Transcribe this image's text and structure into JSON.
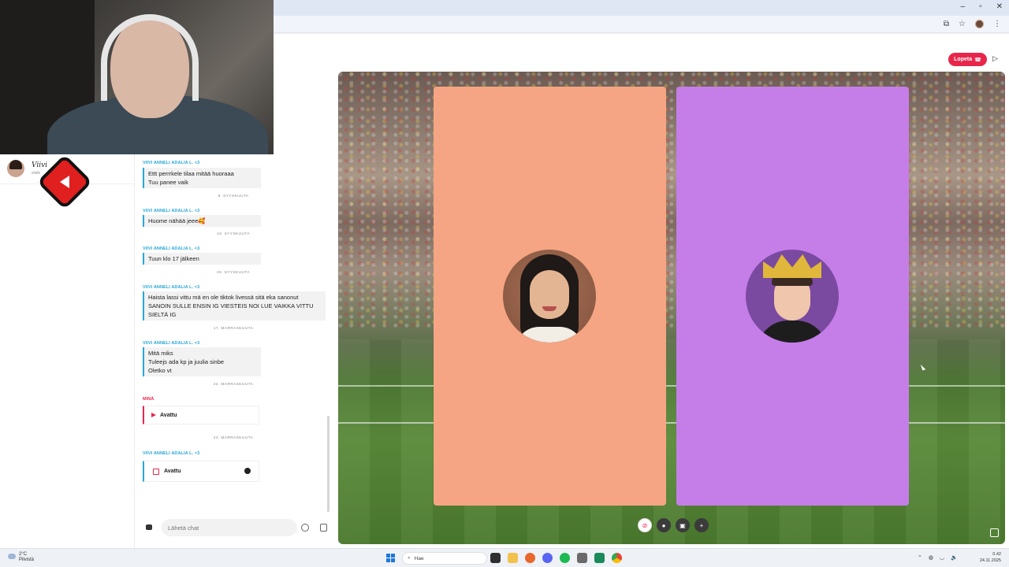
{
  "browser": {
    "window_controls": [
      "–",
      "▫",
      "✕"
    ],
    "profile_icon": "avatar",
    "toolbar_icons": [
      "install-icon",
      "star-icon",
      "menu-icon"
    ]
  },
  "header": {
    "end_call_label": "Lopeta",
    "play_icon": "play-icon"
  },
  "profile": {
    "name": "Viivi",
    "subtitle": "viivik"
  },
  "chat": {
    "messages": [
      {
        "sender": "VIIVI ANNELI ADALIA L. <3",
        "lines": [
          "Ettt perrrkele tilaa mitää huoraaa",
          "Tuu panee vaik"
        ]
      },
      {
        "date": "9. SYYSKUUTA"
      },
      {
        "sender": "VIIVI ANNELI ADALIA L. <3",
        "lines": [
          "Huome nähää jeee🥰"
        ]
      },
      {
        "date": "10. SYYSKUUTA"
      },
      {
        "sender": "VIIVI ANNELI ADALIA L. <3",
        "lines": [
          "Tuun klo 17 jälkeen"
        ]
      },
      {
        "date": "26. SYYSKUUTA"
      },
      {
        "sender": "VIIVI ANNELI ADALIA L. <3",
        "lines": [
          "Haista lassi vittu mä en ole tiktok livessä sitä eka sanonut",
          "SANOIN SULLE ENSIN IG VIESTEIS NOI LUE VAIKKA VITTU SIELTÄ IG"
        ]
      },
      {
        "date": "17. MARRASKUUTA"
      },
      {
        "sender": "VIIVI ANNELI ADALIA L. <3",
        "lines": [
          "Mitä miks",
          "Tuleejs ada kp ja juulia sinbe",
          "Oletko vt"
        ]
      },
      {
        "date": "22. MARRASKUUTA"
      },
      {
        "sender": "MINÄ",
        "snap": "Avattu"
      },
      {
        "date": "23. MARRASKUUTA"
      },
      {
        "sender": "VIIVI ANNELI ADALIA L. <3",
        "snap": "Avattu"
      }
    ],
    "input_placeholder": "Lähetä chat"
  },
  "call": {
    "left_tile_color": "#f5a583",
    "right_tile_color": "#c57ee8",
    "controls": [
      "camera-off-icon",
      "mic-icon",
      "screen-icon",
      "add-person-icon"
    ]
  },
  "taskbar": {
    "weather_temp": "2°C",
    "weather_desc": "Pilvistä",
    "search_label": "Hae",
    "time": "0.42",
    "date": "24.11.2025",
    "apps": [
      "file-explorer-icon",
      "folder-icon",
      "firefox-icon",
      "discord-icon",
      "spotify-icon",
      "app-icon",
      "app-icon-2",
      "chrome-icon"
    ]
  }
}
